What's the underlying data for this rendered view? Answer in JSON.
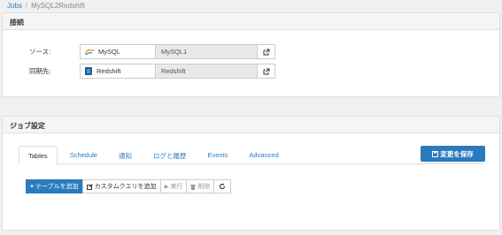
{
  "breadcrumb": {
    "root": "Jobs",
    "separator": "/",
    "current": "MySQL2Redshift"
  },
  "connection_panel": {
    "title": "接続",
    "source": {
      "label": "ソース:",
      "type": "MySQL",
      "name": "MySQL1"
    },
    "destination": {
      "label": "同期先:",
      "type": "Redshift",
      "name": "Redshift"
    }
  },
  "job_panel": {
    "title": "ジョブ設定",
    "tabs": [
      {
        "label": "Tables",
        "active": true
      },
      {
        "label": "Schedule"
      },
      {
        "label": "通知"
      },
      {
        "label": "ログと履歴"
      },
      {
        "label": "Events"
      },
      {
        "label": "Advanced"
      }
    ],
    "save_label": "変更を保存",
    "toolbar": {
      "add_table": "テーブルを追加",
      "custom_query": "カスタムクエリを追加",
      "run": "実行",
      "delete": "削除"
    }
  },
  "colors": {
    "primary": "#2a7bbd",
    "panel_header": "#f5f5f5"
  },
  "icons": [
    "external-link-icon",
    "mysql-logo",
    "redshift-logo",
    "plus-icon",
    "edit-icon",
    "play-icon",
    "trash-icon",
    "refresh-icon",
    "save-icon"
  ]
}
